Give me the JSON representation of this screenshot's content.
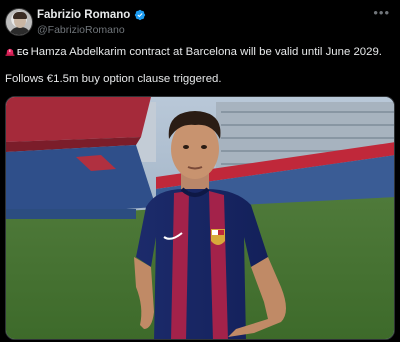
{
  "author": {
    "name": "Fabrizio Romano",
    "handle": "@FabrizioRomano",
    "avatar_icon": "avatar-photo",
    "verified_icon": "verified-badge-icon"
  },
  "tweet": {
    "flag_label": "EG",
    "line1": "Hamza Abdelkarim contract at Barcelona will be valid until June 2029.",
    "line2": "Follows €1.5m buy option clause triggered.",
    "more_label": "•••"
  },
  "colors": {
    "background": "#000000",
    "text": "#e7e9ea",
    "muted": "#71767b",
    "verified": "#1d9bf0",
    "siren": "#e0245e"
  },
  "media": {
    "kind": "photo",
    "subject": "player-in-barcelona-kit"
  }
}
